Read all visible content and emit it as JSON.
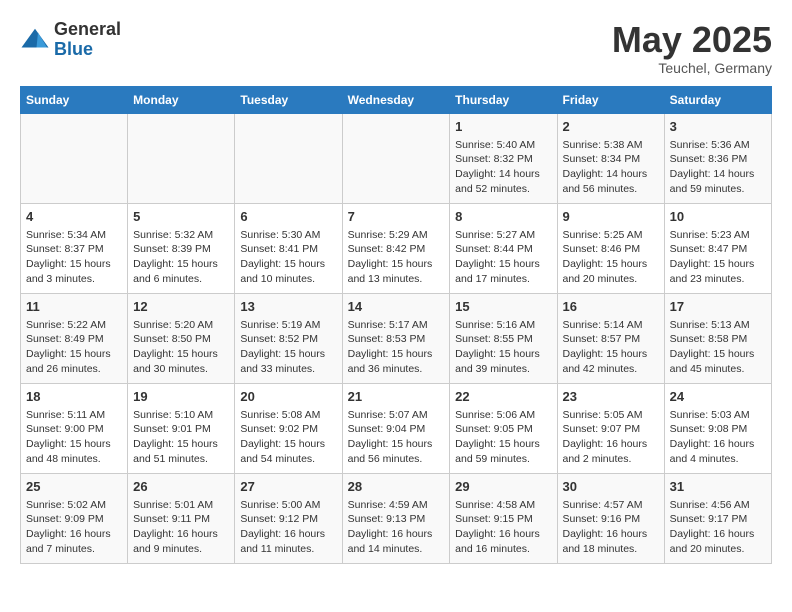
{
  "logo": {
    "general": "General",
    "blue": "Blue"
  },
  "title": "May 2025",
  "subtitle": "Teuchel, Germany",
  "days_of_week": [
    "Sunday",
    "Monday",
    "Tuesday",
    "Wednesday",
    "Thursday",
    "Friday",
    "Saturday"
  ],
  "weeks": [
    [
      {
        "day": "",
        "info": ""
      },
      {
        "day": "",
        "info": ""
      },
      {
        "day": "",
        "info": ""
      },
      {
        "day": "",
        "info": ""
      },
      {
        "day": "1",
        "sunrise": "5:40 AM",
        "sunset": "8:32 PM",
        "daylight": "14 hours and 52 minutes."
      },
      {
        "day": "2",
        "sunrise": "5:38 AM",
        "sunset": "8:34 PM",
        "daylight": "14 hours and 56 minutes."
      },
      {
        "day": "3",
        "sunrise": "5:36 AM",
        "sunset": "8:36 PM",
        "daylight": "14 hours and 59 minutes."
      }
    ],
    [
      {
        "day": "4",
        "sunrise": "5:34 AM",
        "sunset": "8:37 PM",
        "daylight": "15 hours and 3 minutes."
      },
      {
        "day": "5",
        "sunrise": "5:32 AM",
        "sunset": "8:39 PM",
        "daylight": "15 hours and 6 minutes."
      },
      {
        "day": "6",
        "sunrise": "5:30 AM",
        "sunset": "8:41 PM",
        "daylight": "15 hours and 10 minutes."
      },
      {
        "day": "7",
        "sunrise": "5:29 AM",
        "sunset": "8:42 PM",
        "daylight": "15 hours and 13 minutes."
      },
      {
        "day": "8",
        "sunrise": "5:27 AM",
        "sunset": "8:44 PM",
        "daylight": "15 hours and 17 minutes."
      },
      {
        "day": "9",
        "sunrise": "5:25 AM",
        "sunset": "8:46 PM",
        "daylight": "15 hours and 20 minutes."
      },
      {
        "day": "10",
        "sunrise": "5:23 AM",
        "sunset": "8:47 PM",
        "daylight": "15 hours and 23 minutes."
      }
    ],
    [
      {
        "day": "11",
        "sunrise": "5:22 AM",
        "sunset": "8:49 PM",
        "daylight": "15 hours and 26 minutes."
      },
      {
        "day": "12",
        "sunrise": "5:20 AM",
        "sunset": "8:50 PM",
        "daylight": "15 hours and 30 minutes."
      },
      {
        "day": "13",
        "sunrise": "5:19 AM",
        "sunset": "8:52 PM",
        "daylight": "15 hours and 33 minutes."
      },
      {
        "day": "14",
        "sunrise": "5:17 AM",
        "sunset": "8:53 PM",
        "daylight": "15 hours and 36 minutes."
      },
      {
        "day": "15",
        "sunrise": "5:16 AM",
        "sunset": "8:55 PM",
        "daylight": "15 hours and 39 minutes."
      },
      {
        "day": "16",
        "sunrise": "5:14 AM",
        "sunset": "8:57 PM",
        "daylight": "15 hours and 42 minutes."
      },
      {
        "day": "17",
        "sunrise": "5:13 AM",
        "sunset": "8:58 PM",
        "daylight": "15 hours and 45 minutes."
      }
    ],
    [
      {
        "day": "18",
        "sunrise": "5:11 AM",
        "sunset": "9:00 PM",
        "daylight": "15 hours and 48 minutes."
      },
      {
        "day": "19",
        "sunrise": "5:10 AM",
        "sunset": "9:01 PM",
        "daylight": "15 hours and 51 minutes."
      },
      {
        "day": "20",
        "sunrise": "5:08 AM",
        "sunset": "9:02 PM",
        "daylight": "15 hours and 54 minutes."
      },
      {
        "day": "21",
        "sunrise": "5:07 AM",
        "sunset": "9:04 PM",
        "daylight": "15 hours and 56 minutes."
      },
      {
        "day": "22",
        "sunrise": "5:06 AM",
        "sunset": "9:05 PM",
        "daylight": "15 hours and 59 minutes."
      },
      {
        "day": "23",
        "sunrise": "5:05 AM",
        "sunset": "9:07 PM",
        "daylight": "16 hours and 2 minutes."
      },
      {
        "day": "24",
        "sunrise": "5:03 AM",
        "sunset": "9:08 PM",
        "daylight": "16 hours and 4 minutes."
      }
    ],
    [
      {
        "day": "25",
        "sunrise": "5:02 AM",
        "sunset": "9:09 PM",
        "daylight": "16 hours and 7 minutes."
      },
      {
        "day": "26",
        "sunrise": "5:01 AM",
        "sunset": "9:11 PM",
        "daylight": "16 hours and 9 minutes."
      },
      {
        "day": "27",
        "sunrise": "5:00 AM",
        "sunset": "9:12 PM",
        "daylight": "16 hours and 11 minutes."
      },
      {
        "day": "28",
        "sunrise": "4:59 AM",
        "sunset": "9:13 PM",
        "daylight": "16 hours and 14 minutes."
      },
      {
        "day": "29",
        "sunrise": "4:58 AM",
        "sunset": "9:15 PM",
        "daylight": "16 hours and 16 minutes."
      },
      {
        "day": "30",
        "sunrise": "4:57 AM",
        "sunset": "9:16 PM",
        "daylight": "16 hours and 18 minutes."
      },
      {
        "day": "31",
        "sunrise": "4:56 AM",
        "sunset": "9:17 PM",
        "daylight": "16 hours and 20 minutes."
      }
    ]
  ]
}
